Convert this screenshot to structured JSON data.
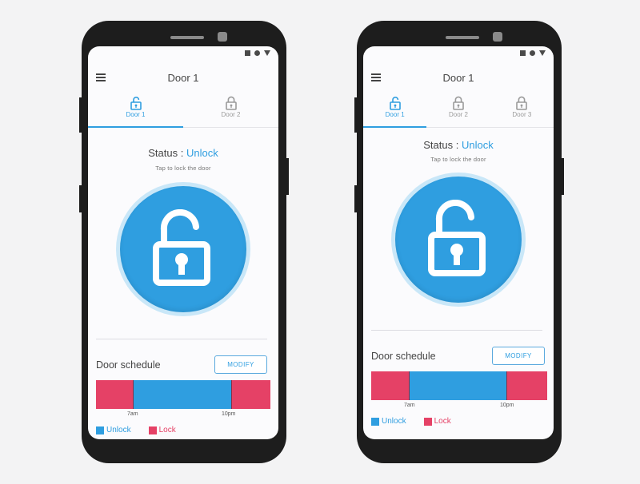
{
  "phones": [
    {
      "title": "Door 1",
      "tabs": [
        {
          "label": "Door 1",
          "active": true
        },
        {
          "label": "Door 2",
          "active": false
        }
      ],
      "status_label": "Status : ",
      "status_value": "Unlock",
      "hint": "Tap to lock the door",
      "schedule_title": "Door schedule",
      "modify_label": "MODIFY",
      "schedule": {
        "lock_until": "7am",
        "unlock_until": "10pm",
        "tick_start": "7am",
        "tick_end": "10pm",
        "unlock_start_frac": 0.21,
        "unlock_end_frac": 0.78
      },
      "legend": [
        {
          "label": "Unlock",
          "color": "#2f9ee0"
        },
        {
          "label": "Lock",
          "color": "#e54166"
        }
      ]
    },
    {
      "title": "Door 1",
      "tabs": [
        {
          "label": "Door 1",
          "active": true
        },
        {
          "label": "Door 2",
          "active": false
        },
        {
          "label": "Door 3",
          "active": false
        }
      ],
      "status_label": "Status : ",
      "status_value": "Unlock",
      "hint": "Tap to lock the door",
      "schedule_title": "Door schedule",
      "modify_label": "MODIFY",
      "schedule": {
        "tick_start": "7am",
        "tick_end": "10pm",
        "unlock_start_frac": 0.21,
        "unlock_end_frac": 0.77
      },
      "legend": [
        {
          "label": "Unlock",
          "color": "#2f9ee0"
        },
        {
          "label": "Lock",
          "color": "#e54166"
        }
      ]
    }
  ],
  "colors": {
    "accent": "#2f9ee0",
    "lock": "#e54166",
    "inactive": "#9a9a9a"
  },
  "icons": {
    "menu": "hamburger-icon",
    "tab": "padlock-icon",
    "main": "unlocked-padlock-icon"
  }
}
